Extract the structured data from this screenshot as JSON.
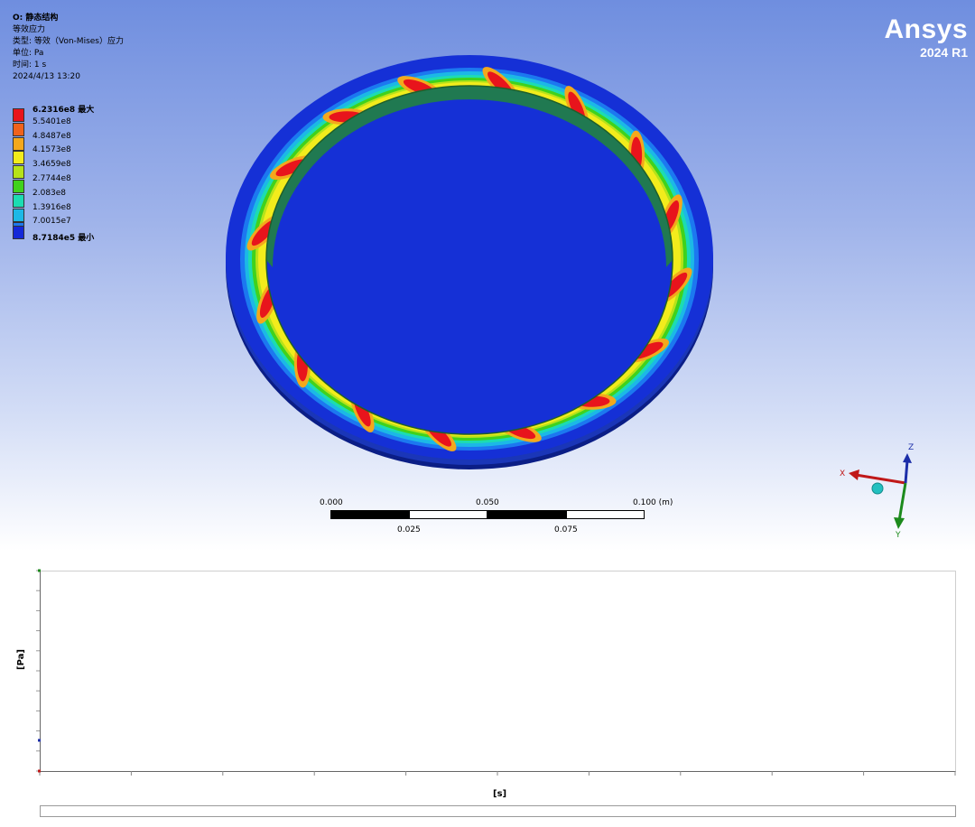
{
  "result": {
    "title": "O: 静态结构",
    "name": "等效应力",
    "type": "类型: 等效（Von-Mises）应力",
    "unit": "单位: Pa",
    "time": "时间: 1 s",
    "date": "2024/4/13 13:20"
  },
  "legend": [
    {
      "label": "6.2316e8 最大",
      "color": "#e8141c",
      "bold": true
    },
    {
      "label": "5.5401e8",
      "color": "#f0621c"
    },
    {
      "label": "4.8487e8",
      "color": "#f4a81c"
    },
    {
      "label": "4.1573e8",
      "color": "#f2ec1c"
    },
    {
      "label": "3.4659e8",
      "color": "#b6e21a"
    },
    {
      "label": "2.7744e8",
      "color": "#40d21c"
    },
    {
      "label": "2.083e8",
      "color": "#1cdcb2"
    },
    {
      "label": "1.3916e8",
      "color": "#1cb8e6"
    },
    {
      "label": "7.0015e7",
      "color": "#1c78f0"
    },
    {
      "label": "8.7184e5 最小",
      "color": "#1428d8",
      "bold": true
    }
  ],
  "brand": {
    "name": "Ansys",
    "version": "2024 R1"
  },
  "scale": {
    "top_labels": [
      "0.000",
      "0.050",
      "0.100 (m)"
    ],
    "bottom_labels": [
      "0.025",
      "0.075"
    ]
  },
  "triad": {
    "x": "X",
    "y": "Y",
    "z": "Z"
  },
  "chart": {
    "ylabel": "[Pa]",
    "xlabel": "[s]"
  }
}
